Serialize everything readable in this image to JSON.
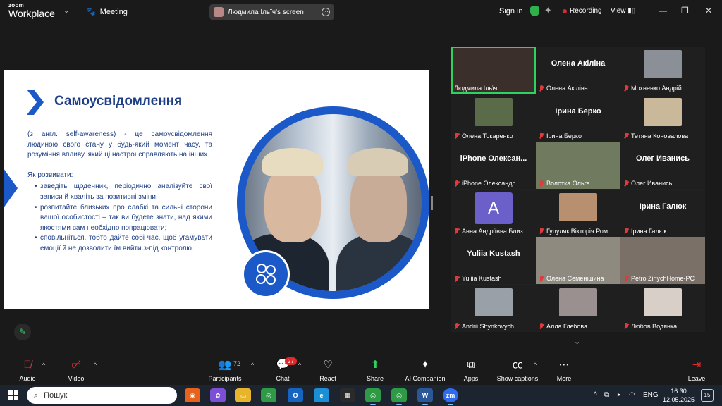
{
  "app": {
    "logo_top": "zoom",
    "logo_bottom": "Workplace",
    "meeting_label": "Meeting"
  },
  "share": {
    "title": "Людмила Ільїч's screen"
  },
  "header": {
    "sign_in": "Sign in",
    "recording": "Recording",
    "view": "View"
  },
  "slide": {
    "title": "Самоусвідомлення",
    "definition": "(з англ. self-awareness) - це самоусвідомлення людиною свого стану у будь-який момент часу, та розуміння впливу, який ці настрої справляють на інших.",
    "subheading": "Як розвивати:",
    "bullets": [
      "заведіть щоденник, періодично аналізуйте свої записи й хваліть за позитивні зміни;",
      "розпитайте близьких про слабкі та сильні сторони вашої особистості – так ви будете знати, над якими якостями вам необхідно попрацювати;",
      "сповільніться, тобто дайте собі час, щоб угамувати емоції й не дозволити їм вийти з-під контролю."
    ]
  },
  "participants": [
    {
      "label": "Людмила Ільїч",
      "name_display": "",
      "type": "video",
      "muted": false,
      "active": true,
      "thumb": "#3a2f2a"
    },
    {
      "label": "Олена Акіліна",
      "name_display": "Олена Акіліна",
      "type": "name",
      "muted": true
    },
    {
      "label": "Мохненко Андрій",
      "name_display": "",
      "type": "photo",
      "muted": true,
      "thumb": "#8a8f98"
    },
    {
      "label": "Олена Токаренко",
      "name_display": "",
      "type": "photo",
      "muted": true,
      "thumb": "#5a6b4a"
    },
    {
      "label": "Ірина Берко",
      "name_display": "Ірина Берко",
      "type": "name",
      "muted": true
    },
    {
      "label": "Тетяна Коновалова",
      "name_display": "",
      "type": "photo",
      "muted": true,
      "thumb": "#c9b89a"
    },
    {
      "label": "iPhone Олександр",
      "name_display": "iPhone Олексан...",
      "type": "name",
      "muted": true
    },
    {
      "label": "Волотка Ольга",
      "name_display": "",
      "type": "video",
      "muted": true,
      "thumb": "#6f7a5e"
    },
    {
      "label": "Олег Иванись",
      "name_display": "Олег Иванись",
      "type": "name",
      "muted": true
    },
    {
      "label": "Анна Андріївна Близ...",
      "name_display": "A",
      "type": "avatar",
      "muted": true
    },
    {
      "label": "Гуцуляк Вікторія Ром...",
      "name_display": "",
      "type": "photo",
      "muted": true,
      "thumb": "#b89070"
    },
    {
      "label": "Ірина Галюк",
      "name_display": "Ірина Галюк",
      "type": "name",
      "muted": true
    },
    {
      "label": "Yuliia Kustash",
      "name_display": "Yuliia Kustash",
      "type": "name",
      "muted": true
    },
    {
      "label": "Олена Семенішина",
      "name_display": "",
      "type": "video",
      "muted": true,
      "thumb": "#8f8a80"
    },
    {
      "label": "Petro ZinychHome-PC",
      "name_display": "",
      "type": "video",
      "muted": true,
      "thumb": "#7a7068"
    },
    {
      "label": "Andrii Shynkovych",
      "name_display": "",
      "type": "photo",
      "muted": true,
      "thumb": "#9aa0a8"
    },
    {
      "label": "Алла Глєбова",
      "name_display": "",
      "type": "photo",
      "muted": true,
      "thumb": "#9a9090"
    },
    {
      "label": "Любов Водянка",
      "name_display": "",
      "type": "photo",
      "muted": true,
      "thumb": "#d8d0c8"
    }
  ],
  "toolbar": {
    "audio": "Audio",
    "video": "Video",
    "participants": "Participants",
    "participants_count": "72",
    "chat": "Chat",
    "chat_badge": "27",
    "react": "React",
    "share": "Share",
    "ai": "AI Companion",
    "apps": "Apps",
    "captions": "Show captions",
    "more": "More",
    "leave": "Leave"
  },
  "taskbar": {
    "search_placeholder": "Пошук",
    "lang": "ENG",
    "time": "16:30",
    "date": "12.05.2025",
    "notifications": "15"
  },
  "colors": {
    "brand_blue": "#1b58c8",
    "title_blue": "#1e3f86",
    "active_green": "#2fd25c",
    "muted_red": "#e03a3a"
  }
}
